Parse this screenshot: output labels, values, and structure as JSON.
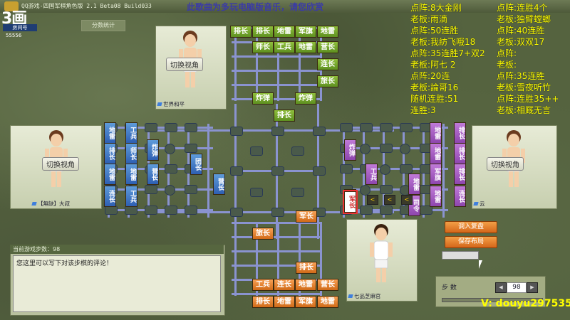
{
  "app": {
    "title": "QQ游戏-四国军棋角色版 2.1 Beta08 Build033",
    "scroll_message": "此歌曲为多玩电脑版音乐，请您欣赏"
  },
  "room": {
    "logo_text": "3画",
    "label": "房间号",
    "number": "55556"
  },
  "score_stats_label": "分数统计",
  "players": {
    "top": {
      "view_label": "切换视角",
      "name": "世界和平"
    },
    "left": {
      "view_label": "切换视角",
      "name": "【無缺】大叔"
    },
    "right": {
      "view_label": "切换视角",
      "name": "云"
    },
    "bottom": {
      "name": "七品芝麻官"
    }
  },
  "pieces": {
    "top_rows": [
      [
        "排长",
        "排长",
        "地雷",
        "军旗",
        "地雷"
      ],
      [
        "师长",
        "工兵",
        "地雷",
        "营长"
      ],
      [
        "连长"
      ],
      [
        "旅长"
      ],
      [
        "炸弹",
        "炸弹"
      ],
      [
        "排长"
      ]
    ],
    "bottom_rows": [
      [
        "军长"
      ],
      [
        "旅长"
      ],
      [
        "排长"
      ],
      [
        "工兵",
        "连长",
        "地雷",
        "营长"
      ],
      [
        "排长",
        "地雷",
        "军旗",
        "地雷"
      ]
    ],
    "left_cols": [
      [
        "地雷",
        "排长",
        "地雷",
        "连长"
      ],
      [
        "工兵",
        "师长",
        "地雷"
      ],
      [
        "炸弹",
        "营长"
      ],
      [
        "团长"
      ],
      [
        "营长"
      ],
      [
        "工兵"
      ]
    ],
    "right_cols": [
      [
        "排长",
        "排长",
        "排长",
        "连长"
      ],
      [
        "地雷",
        "地雷",
        "军旗",
        "地雷",
        "地雷"
      ],
      [
        "炸弹",
        "司令"
      ],
      [
        "工兵"
      ],
      [
        "军长"
      ]
    ],
    "highlight_label": "军长"
  },
  "stats": [
    {
      "label": "点阵:",
      "value": "8大金刚"
    },
    {
      "label": "老板:",
      "value": "雨滴"
    },
    {
      "label": "点阵:",
      "value": "50连胜"
    },
    {
      "label": "老板:",
      "value": "我紡飞哦18"
    },
    {
      "label": "点阵:",
      "value": "35连胜7+双2"
    },
    {
      "label": "老板:",
      "value": "阿七 2"
    },
    {
      "label": "点阵:",
      "value": "20连"
    },
    {
      "label": "老板:",
      "value": "論哥16"
    },
    {
      "label": "随机连胜:",
      "value": "51"
    },
    {
      "label": "连胜:",
      "value": "3"
    }
  ],
  "stats_right": [
    {
      "label": "点阵:",
      "value": "连胜4个"
    },
    {
      "label": "老板:",
      "value": "独臂螳螂"
    },
    {
      "label": "点阵:",
      "value": "40连胜"
    },
    {
      "label": "老板:",
      "value": "双双17"
    },
    {
      "label": "点阵:",
      "value": ""
    },
    {
      "label": "老板:",
      "value": ""
    },
    {
      "label": "点阵:",
      "value": "35连胜"
    },
    {
      "label": "老板:",
      "value": "雪夜听竹"
    },
    {
      "label": "点阵:",
      "value": "连胜35++"
    },
    {
      "label": "老板:",
      "value": "相厩无言"
    }
  ],
  "game_steps_label": "当前游戏步数：98",
  "comment_placeholder": "您这里可以写下对该步棋的评论！",
  "buttons": {
    "load_replay": "调入复盘",
    "save_layout": "保存布局"
  },
  "step": {
    "label": "步 数",
    "value": "98"
  },
  "watermark": "V: douyu297535",
  "colors": {
    "green_player": "#6ea82a",
    "orange_player": "#e07a24",
    "blue_player": "#3c6fc2",
    "purple_player": "#a45dc6",
    "stat_yellow": "#ffff00"
  }
}
